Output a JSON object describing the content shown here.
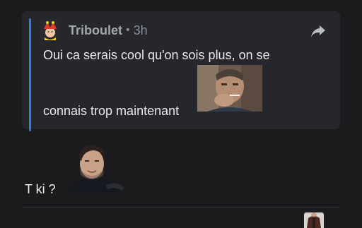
{
  "quoted_message": {
    "author": "Triboulet",
    "separator": "•",
    "time": "3h",
    "line1": "Oui ca serais cool qu'on sois plus, on se",
    "line2": "connais trop maintenant",
    "avatar_icon": "jester-avatar-icon",
    "sticker": "smoking-man-sticker",
    "accent_color": "#2f7fe2"
  },
  "share": {
    "icon": "share-arrow-icon"
  },
  "message": {
    "text": "T ki ?",
    "sticker": "man-portrait-sticker"
  },
  "next_message": {
    "avatar_icon": "leather-jacket-avatar-icon"
  }
}
